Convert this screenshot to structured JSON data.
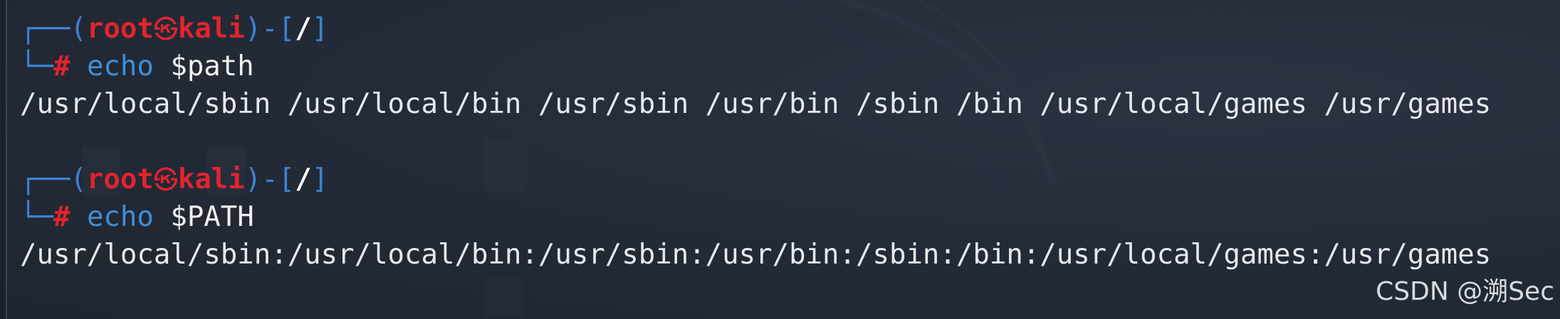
{
  "terminal": {
    "blocks": [
      {
        "prompt_open": "┌──(",
        "user": "root",
        "skull": "㉿",
        "host": "kali",
        "prompt_mid": ")-[",
        "dir": "/",
        "prompt_close": "]",
        "corner": "└─",
        "hash": "#",
        "command": "echo",
        "argument": "$path",
        "output": "/usr/local/sbin /usr/local/bin /usr/sbin /usr/bin /sbin /bin /usr/local/games /usr/games"
      },
      {
        "prompt_open": "┌──(",
        "user": "root",
        "skull": "㉿",
        "host": "kali",
        "prompt_mid": ")-[",
        "dir": "/",
        "prompt_close": "]",
        "corner": "└─",
        "hash": "#",
        "command": "echo",
        "argument": "$PATH",
        "output": "/usr/local/sbin:/usr/local/bin:/usr/sbin:/usr/bin:/sbin:/bin:/usr/local/games:/usr/games"
      }
    ]
  },
  "watermark": "CSDN @溯Sec",
  "colors": {
    "background": "#232a37",
    "prompt_box": "#3b82d6",
    "user_host": "#e0242e",
    "command": "#3f8fd8",
    "output": "#e7e9ee"
  }
}
